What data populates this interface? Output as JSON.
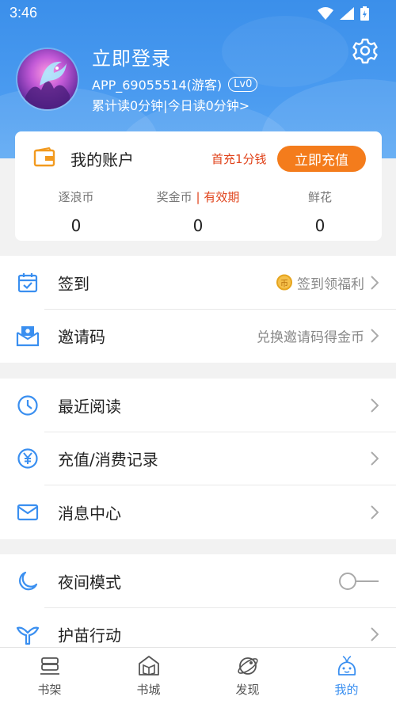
{
  "status_bar": {
    "time": "3:46"
  },
  "profile": {
    "login_title": "立即登录",
    "user_id": "APP_69055514(游客)",
    "level": "Lv0",
    "reading_time": "累计读0分钟|今日读0分钟>"
  },
  "account": {
    "title": "我的账户",
    "first_charge": "首充1分钱",
    "recharge_label": "立即充值",
    "stats": [
      {
        "label": "逐浪币",
        "value": "0"
      },
      {
        "label": "奖金币",
        "sep": "|",
        "extra": "有效期",
        "value": "0"
      },
      {
        "label": "鲜花",
        "value": "0"
      }
    ]
  },
  "menu": {
    "sign_in": {
      "label": "签到",
      "right": "签到领福利",
      "coin": "币"
    },
    "invite": {
      "label": "邀请码",
      "right": "兑换邀请码得金币"
    },
    "recent": {
      "label": "最近阅读"
    },
    "records": {
      "label": "充值/消费记录"
    },
    "messages": {
      "label": "消息中心"
    },
    "night": {
      "label": "夜间模式",
      "enabled": false
    },
    "seedling": {
      "label": "护苗行动"
    }
  },
  "tabs": [
    {
      "label": "书架",
      "icon": "bookshelf-icon"
    },
    {
      "label": "书城",
      "icon": "bookstore-icon"
    },
    {
      "label": "发现",
      "icon": "planet-icon"
    },
    {
      "label": "我的",
      "icon": "mascot-icon",
      "active": true
    }
  ],
  "colors": {
    "primary": "#3a8ff0",
    "accent": "#f47c1c",
    "warning": "#e0431b"
  }
}
